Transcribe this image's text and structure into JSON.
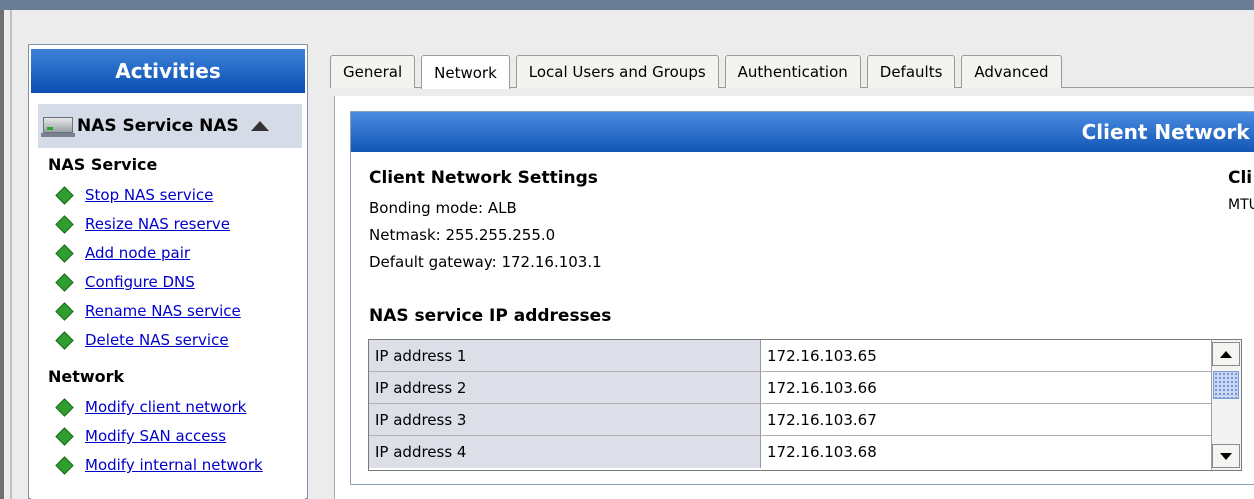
{
  "activities": {
    "title": "Activities",
    "service_header": "NAS Service NAS",
    "sections": [
      {
        "title": "NAS Service",
        "items": [
          "Stop NAS service",
          "Resize NAS reserve",
          "Add node pair",
          "Configure DNS",
          "Rename NAS service",
          "Delete NAS service"
        ]
      },
      {
        "title": "Network",
        "items": [
          "Modify client network",
          "Modify SAN access",
          "Modify internal network"
        ]
      }
    ]
  },
  "tabs": [
    "General",
    "Network",
    "Local Users and Groups",
    "Authentication",
    "Defaults",
    "Advanced"
  ],
  "active_tab": "Network",
  "panel": {
    "header": "Client Network I",
    "settings_title": "Client Network Settings",
    "bonding_mode": "Bonding mode:  ALB",
    "netmask": "Netmask:  255.255.255.0",
    "gateway": "Default gateway:  172.16.103.1",
    "right_title": "Cli",
    "right_mtu": "MTU",
    "ip_title": "NAS service IP addresses",
    "ip_rows": [
      {
        "label": "IP address 1",
        "value": "172.16.103.65"
      },
      {
        "label": "IP address 2",
        "value": "172.16.103.66"
      },
      {
        "label": "IP address 3",
        "value": "172.16.103.67"
      },
      {
        "label": "IP address 4",
        "value": "172.16.103.68"
      }
    ]
  },
  "colors": {
    "header_blue": "#1256b6",
    "link_blue": "#0000cc",
    "bullet_green": "#2e9e2e",
    "ip_label_bg": "#dcdfe8"
  },
  "icons": {
    "service": "server-icon",
    "collapse": "chevron-up-icon",
    "bullet": "diamond-icon",
    "scroll_up": "arrow-up-icon",
    "scroll_down": "arrow-down-icon"
  }
}
